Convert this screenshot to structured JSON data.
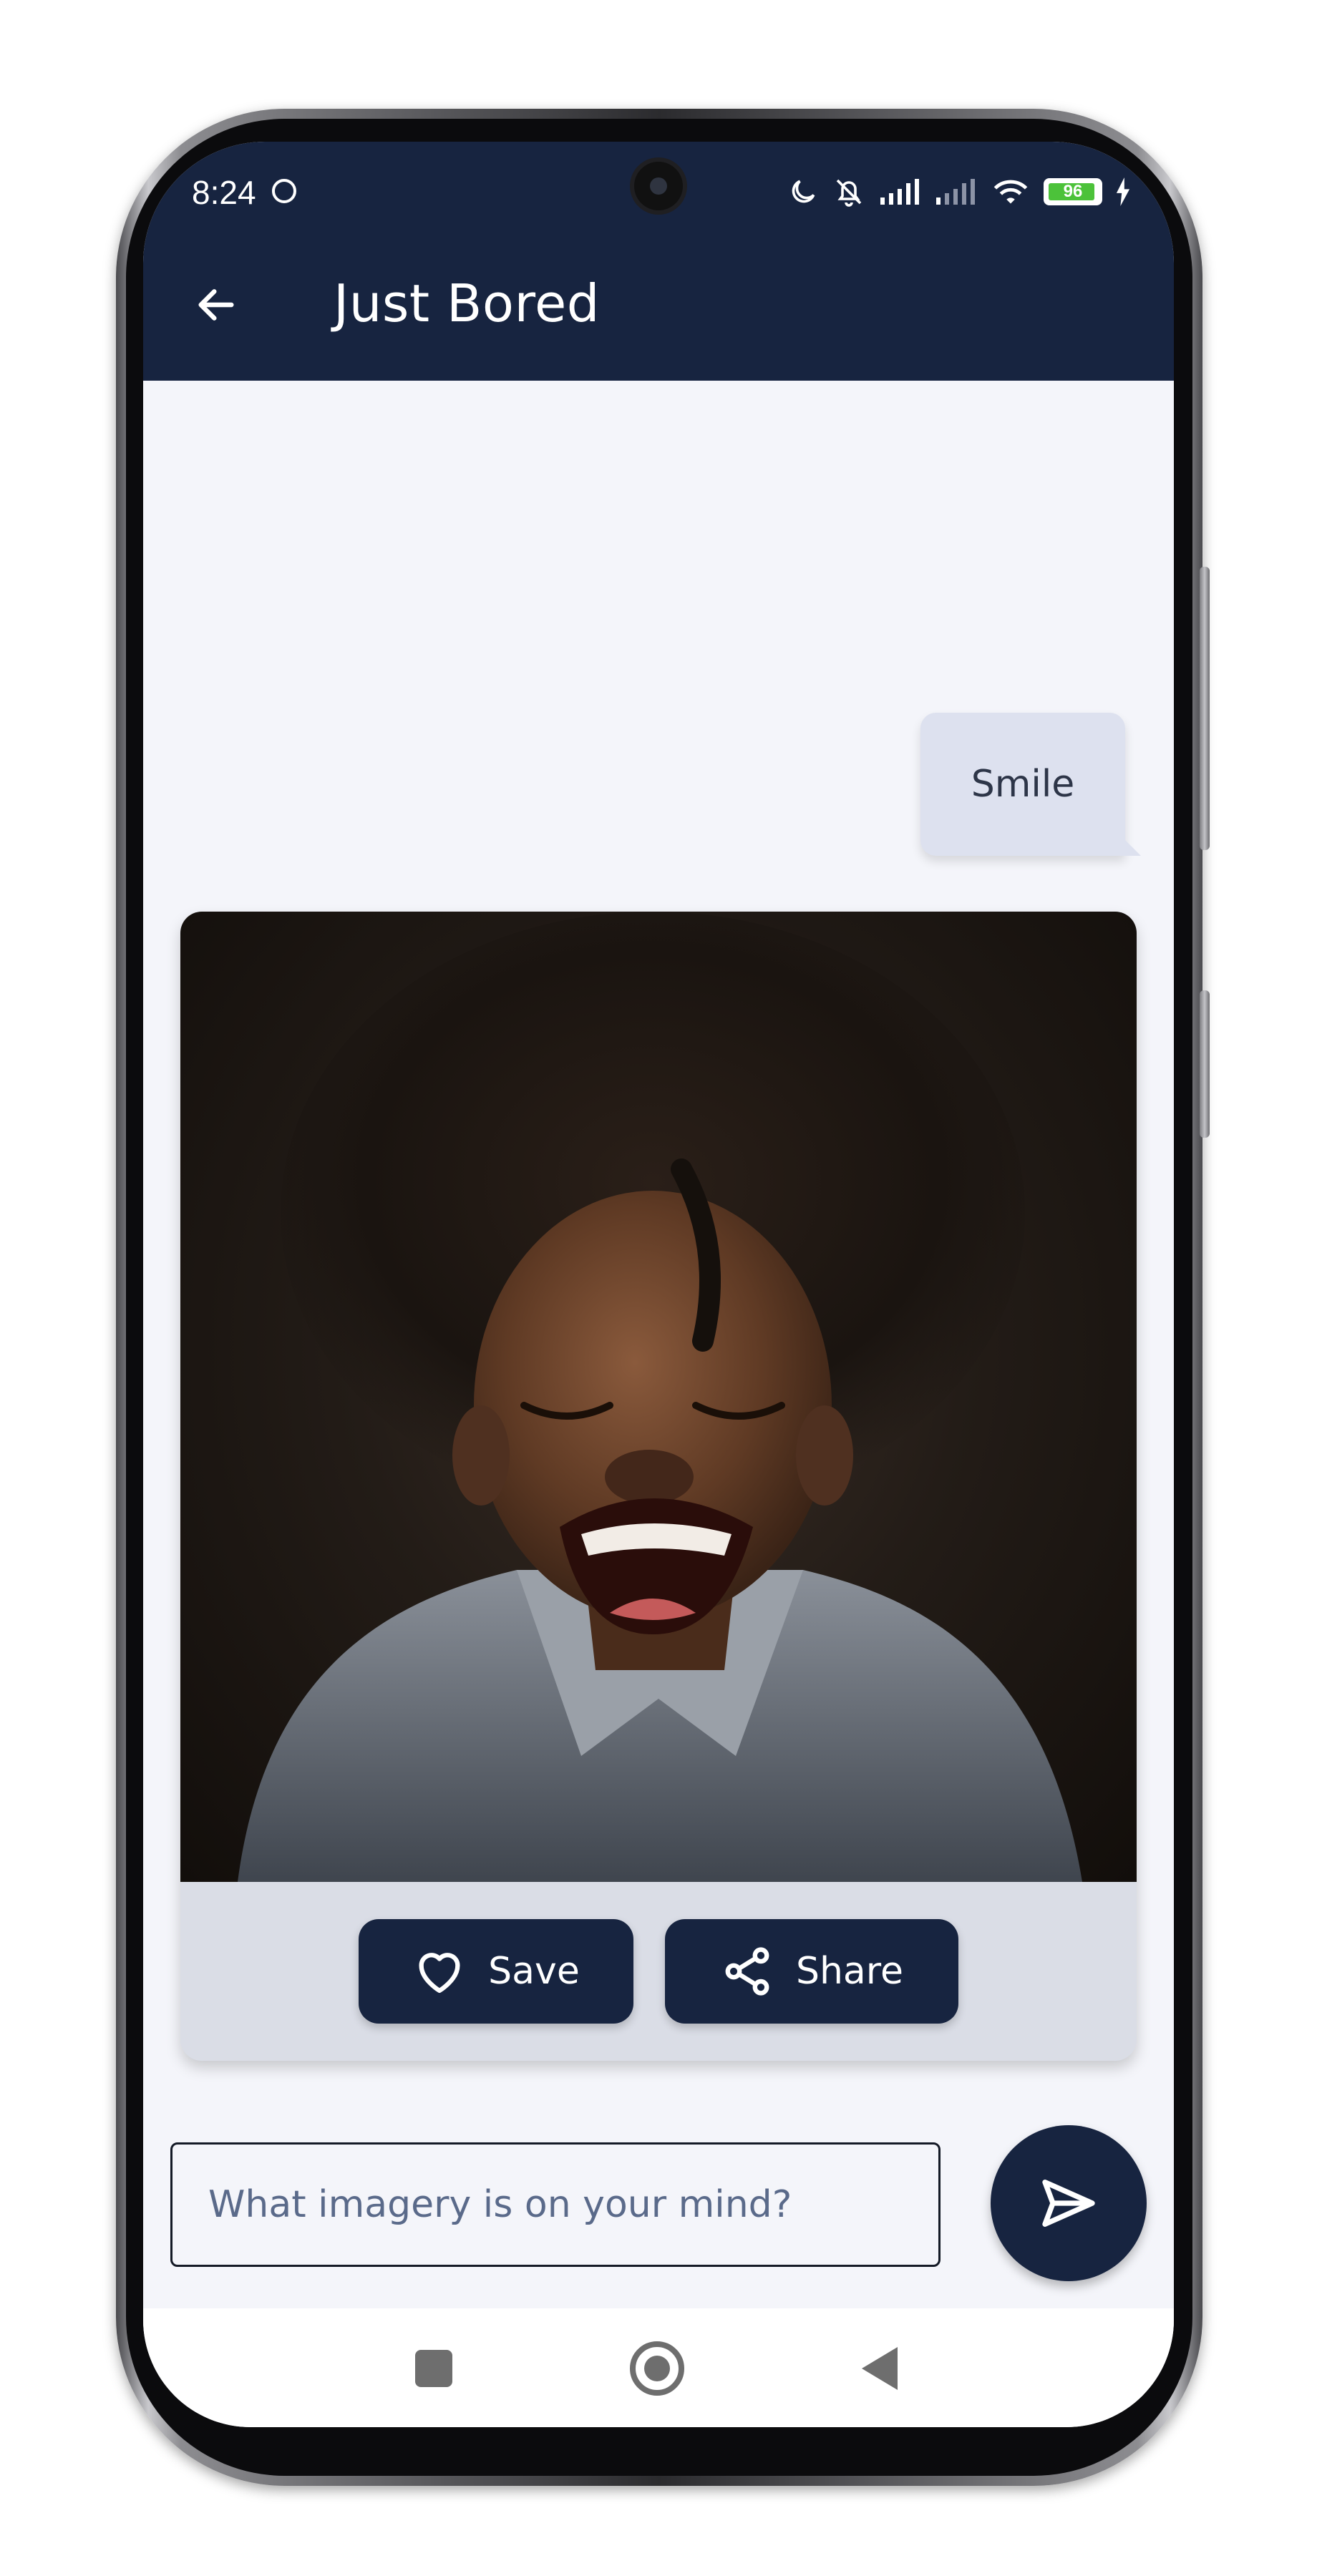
{
  "status_bar": {
    "time": "8:24",
    "battery_level": "96"
  },
  "app_bar": {
    "title": "Just Bored",
    "back_icon": "arrow-left-icon"
  },
  "chat": {
    "user_message": "Smile",
    "generated_image_subject": "smiling-child-photo",
    "actions": {
      "save_label": "Save",
      "save_icon": "heart-icon",
      "share_label": "Share",
      "share_icon": "share-icon"
    }
  },
  "composer": {
    "placeholder": "What imagery is on your mind?",
    "value": "",
    "send_icon": "send-icon"
  },
  "colors": {
    "primary": "#172440",
    "background": "#f4f5fa",
    "bubble": "#dde1ef",
    "card_footer": "#dadde6",
    "battery_green": "#4cc23a"
  }
}
